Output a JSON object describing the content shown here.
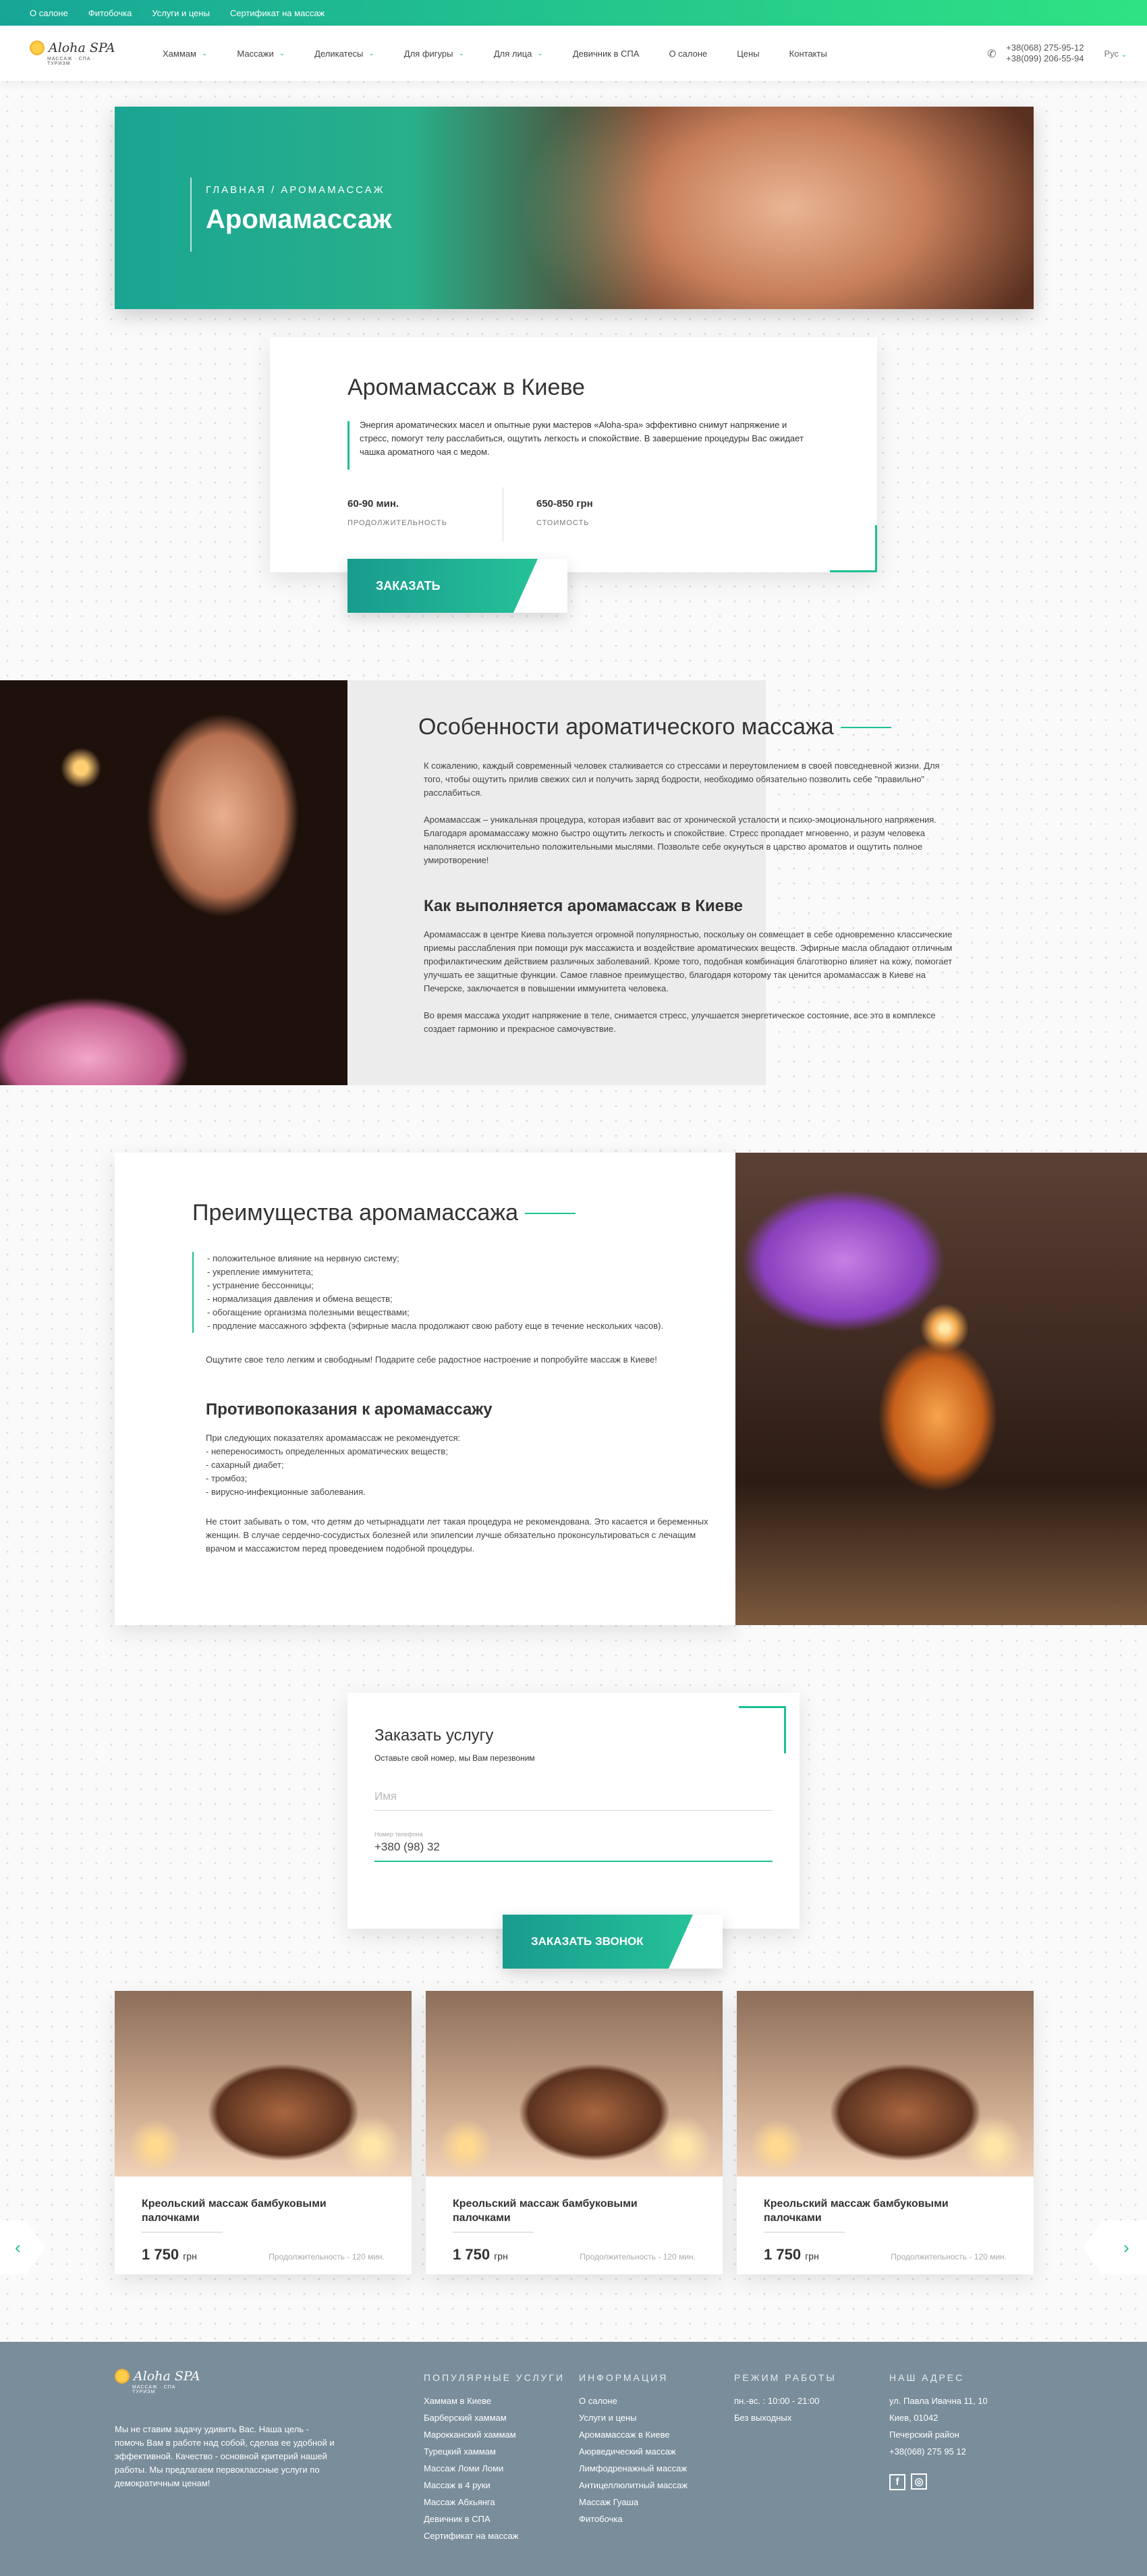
{
  "topbar": {
    "links": [
      "О салоне",
      "Фитобочка",
      "Услуги и цены",
      "Сертификат на массаж"
    ]
  },
  "logo": {
    "name": "Aloha SPA",
    "tagline": "МАССАЖ · СПА · ТУРИЗМ"
  },
  "nav": {
    "items": [
      "Хаммам",
      "Массажи",
      "Деликатесы",
      "Для фигуры",
      "Для лица",
      "Девичник в СПА",
      "О салоне",
      "Цены",
      "Контакты"
    ],
    "has_dropdown": [
      true,
      true,
      true,
      true,
      true,
      false,
      false,
      false,
      false
    ]
  },
  "phones": [
    "+38(068) 275-95-12",
    "+38(099) 206-55-94"
  ],
  "lang": "Рус",
  "hero": {
    "breadcrumb": "ГЛАВНАЯ / АРОМАМАССАЖ",
    "title": "Аромамассаж"
  },
  "intro": {
    "title": "Аромамассаж в Киеве",
    "text": "Энергия ароматических масел и опытные руки мастеров «Aloha-spa» эффективно снимут напряжение и стресс, помогут телу расслабиться, ощутить легкость и спокойствие. В завершение процедуры Вас ожидает чашка ароматного чая с медом.",
    "duration_value": "60-90 мин.",
    "duration_label": "ПРОДОЛЖИТЕЛЬНОСТЬ",
    "price_value": "650-850 грн",
    "price_label": "СТОИМОСТЬ",
    "cta": "ЗАКАЗАТЬ"
  },
  "features": {
    "title": "Особенности ароматического массажа",
    "p1": "К сожалению, каждый современный человек сталкивается со стрессами и переутомлением в своей повседневной жизни. Для того, чтобы ощутить прилив свежих сил и получить заряд бодрости, необходимо обязательно позволить себе \"правильно\" расслабиться.",
    "p2": "Аромамассаж – уникальная процедура, которая избавит вас от хронической усталости и психо-эмоционального напряжения. Благодаря аромамассажу можно быстро ощутить легкость и спокойствие. Стресс пропадает мгновенно, и разум человека наполняется исключительно положительными мыслями. Позвольте себе окунуться в царство ароматов и ощутить полное умиротворение!",
    "h2": "Как выполняется аромамассаж в Киеве",
    "p3": "Аромамассаж в центре Киева пользуется огромной популярностью, поскольку он совмещает в себе одновременно классические приемы расслабления при помощи рук массажиста и воздействие ароматических веществ. Эфирные масла обладают отличным профилактическим действием различных заболеваний. Кроме того, подобная комбинация благотворно влияет на кожу, помогает улучшать ее защитные функции. Самое главное преимущество, благодаря которому так ценится аромамассаж в Киеве на Печерске, заключается в повышении иммунитета человека.",
    "p4": "Во время массажа уходит напряжение в теле, снимается стресс, улучшается энергетическое состояние, все это в комплексе создает гармонию и прекрасное самочувствие."
  },
  "advantages": {
    "title": "Преимущества аромамассажа",
    "items": [
      "- положительное влияние на нервную систему;",
      "- укрепление иммунитета;",
      "- устранение бессонницы;",
      "- нормализация давления и обмена веществ;",
      "- обогащение организма полезными веществами;",
      "- продление массажного эффекта (эфирные масла продолжают свою работу еще в течение нескольких часов)."
    ],
    "note": "Ощутите свое тело легким и свободным! Подарите себе радостное настроение и попробуйте массаж в Киеве!",
    "contra_title": "Противопоказания к аромамассажу",
    "contra_intro": "При следующих показателях аромамассаж не рекомендуется:",
    "contra_items": [
      "- непереносимость определенных ароматических веществ;",
      "- сахарный диабет;",
      "- тромбоз;",
      "- вирусно-инфекционные заболевания."
    ],
    "contra_note": "Не стоит забывать о том, что детям до четырнадцати лет такая процедура не рекомендована. Это касается и беременных женщин. В случае сердечно-сосудистых болезней или эпилепсии лучше обязательно проконсультироваться с лечащим врачом и массажистом перед проведением подобной процедуры."
  },
  "order": {
    "title": "Заказать услугу",
    "subtitle": "Оставьте свой номер, мы Вам перезвоним",
    "name_placeholder": "Имя",
    "phone_label": "Номер телефона",
    "phone_value": "+380 (98) 32",
    "cta": "ЗАКАЗАТЬ ЗВОНОК"
  },
  "products": [
    {
      "title": "Креольский массаж бамбуковыми палочками",
      "price": "1 750",
      "currency": "грн",
      "duration": "Продолжительность - 120 мин."
    },
    {
      "title": "Креольский массаж бамбуковыми палочками",
      "price": "1 750",
      "currency": "грн",
      "duration": "Продолжительность - 120 мин."
    },
    {
      "title": "Креольский массаж бамбуковыми палочками",
      "price": "1 750",
      "currency": "грн",
      "duration": "Продолжительность - 120 мин."
    }
  ],
  "slider": {
    "prev": "‹",
    "next": "›"
  },
  "footer": {
    "about": "Мы не ставим задачу удивить Вас. Наша цель - помочь Вам в работе над собой, сделав ее удобной и эффективной. Качество - основной критерий нашей работы. Мы предлагаем первоклассные услуги по демократичным ценам!",
    "popular_title": "ПОПУЛЯРНЫЕ УСЛУГИ",
    "popular": [
      "Хаммам в Киеве",
      "Барберский хаммам",
      "Марокканский хаммам",
      "Турецкий хаммам",
      "Массаж Ломи Ломи",
      "Массаж в 4 руки",
      "Массаж Абхьянга",
      "Девичник в СПА",
      "Сертификат на массаж"
    ],
    "info_title": "ИНФОРМАЦИЯ",
    "info": [
      "О салоне",
      "Услуги и цены",
      "Аромамассаж в Киеве",
      "Аюрведический массаж",
      "Лимфодренажный массаж",
      "Антицеллюлитный массаж",
      "Массаж Гуаша",
      "Фитобочка"
    ],
    "hours_title": "РЕЖИМ РАБОТЫ",
    "hours": [
      "пн.-вс. : 10:00 - 21:00",
      "Без выходных"
    ],
    "address_title": "НАШ АДРЕС",
    "address": [
      "ул. Павла Ивачна 11, 10",
      "Киев, 01042",
      "Печерский район",
      "+38(068) 275 95 12"
    ],
    "social": [
      "f",
      "◎"
    ]
  },
  "colors": {
    "accent": "#1fbf94",
    "accent_dark": "#17a697",
    "footer_bg": "#7a8d9a"
  }
}
